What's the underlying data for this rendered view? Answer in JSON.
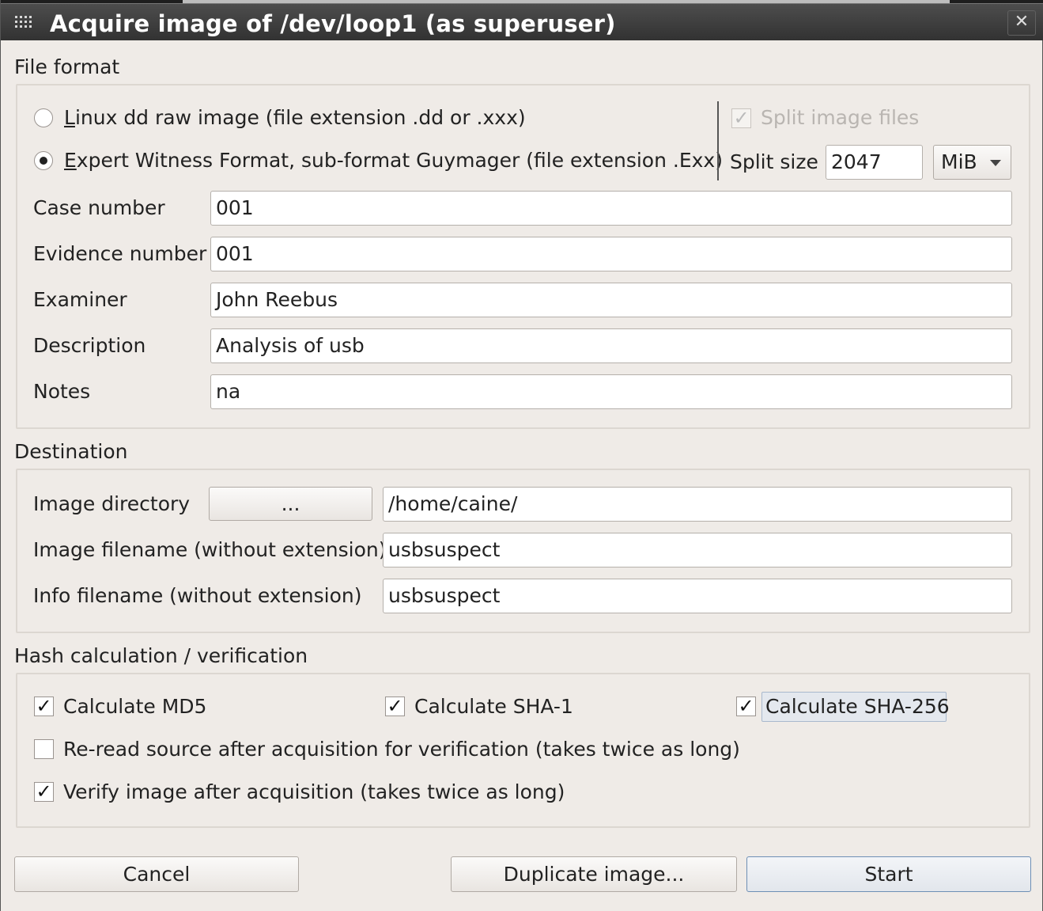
{
  "window": {
    "title": "Acquire image of /dev/loop1 (as superuser)",
    "close_glyph": "✕"
  },
  "file_format": {
    "section_label": "File format",
    "option_dd": {
      "accel": "L",
      "rest": "inux dd raw image (file extension .dd or .xxx)",
      "selected": false
    },
    "option_ewf": {
      "accel": "E",
      "rest": "xpert Witness Format, sub-format Guymager (file extension .Exx)",
      "selected": true
    },
    "split_image_files": {
      "label": "Split image files",
      "checked": true,
      "enabled": false
    },
    "split_size": {
      "label": "Split size",
      "value": "2047",
      "unit": "MiB"
    },
    "fields": [
      {
        "label": "Case number",
        "value": "001"
      },
      {
        "label": "Evidence number",
        "value": "001"
      },
      {
        "label": "Examiner",
        "value": "John Reebus"
      },
      {
        "label": "Description",
        "value": "Analysis of usb"
      },
      {
        "label": "Notes",
        "value": "na"
      }
    ]
  },
  "destination": {
    "section_label": "Destination",
    "image_directory": {
      "label": "Image directory",
      "browse_label": "...",
      "value": "/home/caine/"
    },
    "image_filename": {
      "label": "Image filename (without extension)",
      "value": "usbsuspect"
    },
    "info_filename": {
      "label": "Info filename (without extension)",
      "value": "usbsuspect"
    }
  },
  "hash": {
    "section_label": "Hash calculation / verification",
    "md5": {
      "label": "Calculate MD5",
      "checked": true
    },
    "sha1": {
      "label": "Calculate SHA-1",
      "checked": true
    },
    "sha256": {
      "label": "Calculate SHA-256",
      "checked": true
    },
    "reread": {
      "label": "Re-read source after acquisition for verification (takes twice as long)",
      "checked": false
    },
    "verify": {
      "label": "Verify image after acquisition (takes twice as long)",
      "checked": true
    }
  },
  "buttons": {
    "cancel": "Cancel",
    "duplicate": "Duplicate image...",
    "start": "Start"
  },
  "glyphs": {
    "check": "✓"
  }
}
